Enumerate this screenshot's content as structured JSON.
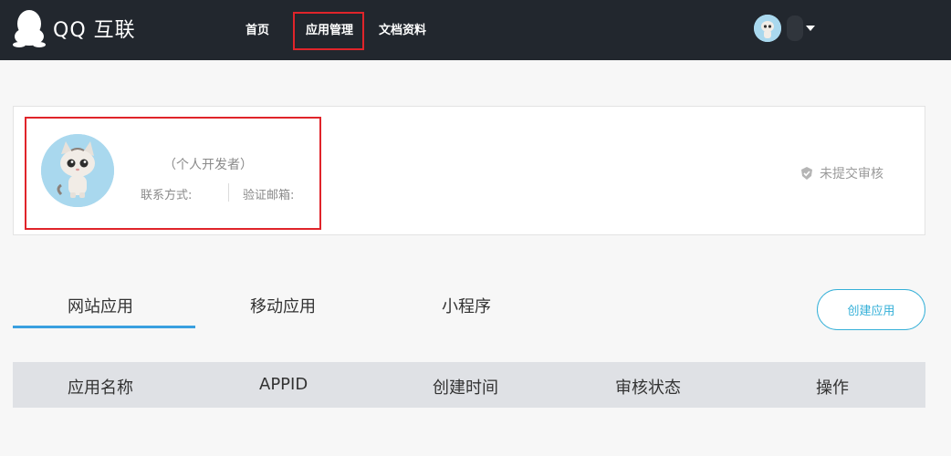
{
  "header": {
    "brand": "QQ 互联",
    "nav": {
      "home": "首页",
      "app_management": "应用管理",
      "docs": "文档资料"
    }
  },
  "profile": {
    "developer_type": "（个人开发者）",
    "contact_label": "联系方式:",
    "email_label": "验证邮箱:",
    "review_status": "未提交审核"
  },
  "tabs": {
    "web_apps": "网站应用",
    "mobile_apps": "移动应用",
    "mini_programs": "小程序"
  },
  "create_button": "创建应用",
  "table": {
    "columns": [
      "应用名称",
      "APPID",
      "创建时间",
      "审核状态",
      "操作"
    ]
  },
  "colors": {
    "header_bg": "#22272e",
    "accent": "#3aa0e0",
    "highlight": "#e0242a"
  }
}
